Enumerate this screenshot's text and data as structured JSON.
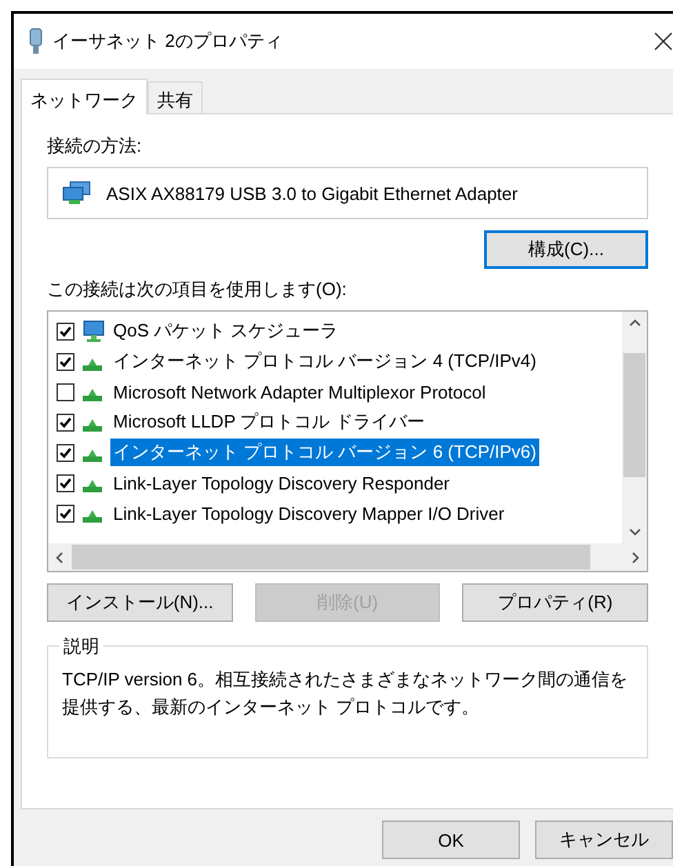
{
  "window": {
    "title": "イーサネット 2のプロパティ"
  },
  "tabs": [
    {
      "label": "ネットワーク",
      "selected": true
    },
    {
      "label": "共有",
      "selected": false
    }
  ],
  "connect_using": {
    "label": "接続の方法:",
    "adapter": "ASIX AX88179 USB 3.0 to Gigabit Ethernet Adapter",
    "configure_button": "構成(C)..."
  },
  "items_label": "この接続は次の項目を使用します(O):",
  "items": [
    {
      "label": "QoS パケット スケジューラ",
      "kind": "service",
      "checked": true,
      "selected": false
    },
    {
      "label": "インターネット プロトコル バージョン 4 (TCP/IPv4)",
      "kind": "protocol",
      "checked": true,
      "selected": false
    },
    {
      "label": "Microsoft Network Adapter Multiplexor Protocol",
      "kind": "protocol",
      "checked": false,
      "selected": false
    },
    {
      "label": "Microsoft LLDP プロトコル ドライバー",
      "kind": "protocol",
      "checked": true,
      "selected": false
    },
    {
      "label": "インターネット プロトコル バージョン 6 (TCP/IPv6)",
      "kind": "protocol",
      "checked": true,
      "selected": true
    },
    {
      "label": "Link-Layer Topology Discovery Responder",
      "kind": "protocol",
      "checked": true,
      "selected": false
    },
    {
      "label": "Link-Layer Topology Discovery Mapper I/O Driver",
      "kind": "protocol",
      "checked": true,
      "selected": false
    }
  ],
  "item_buttons": [
    {
      "label": "インストール(N)...",
      "disabled": false
    },
    {
      "label": "削除(U)",
      "disabled": true
    },
    {
      "label": "プロパティ(R)",
      "disabled": false
    }
  ],
  "description": {
    "legend": "説明",
    "text": "TCP/IP version 6。相互接続されたさまざまなネットワーク間の通信を提供する、最新のインターネット プロトコルです。"
  },
  "dialog_buttons": [
    {
      "label": "OK"
    },
    {
      "label": "キャンセル"
    }
  ]
}
